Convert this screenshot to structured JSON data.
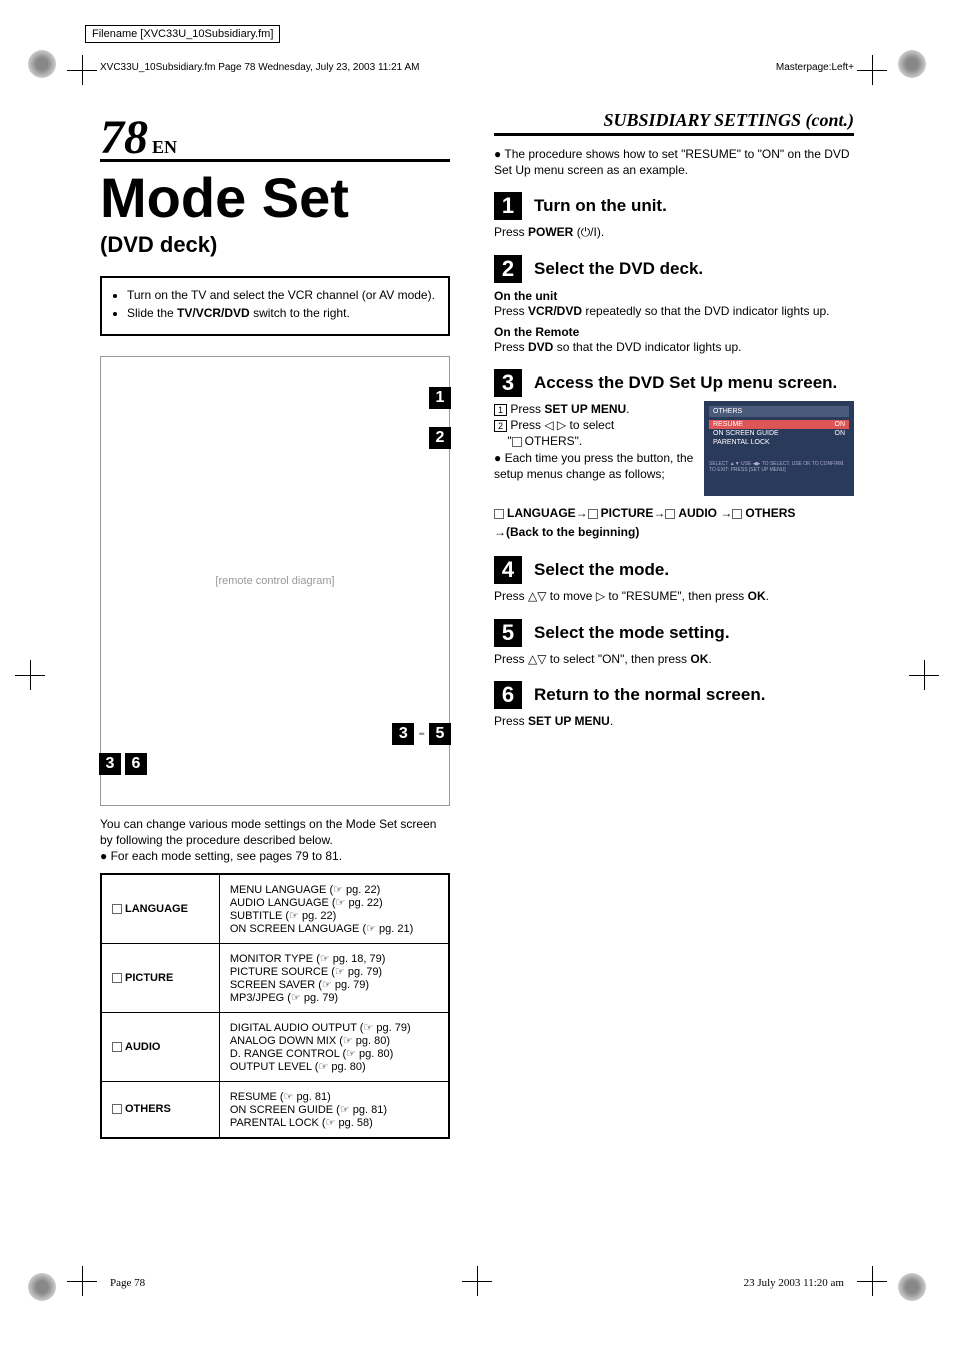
{
  "meta": {
    "filename_box": "Filename [XVC33U_10Subsidiary.fm]",
    "header_line": "XVC33U_10Subsidiary.fm  Page 78  Wednesday, July 23, 2003  11:21 AM",
    "masterpage": "Masterpage:Left+",
    "footer_left": "Page 78",
    "footer_right": "23 July 2003 11:20 am"
  },
  "page": {
    "number": "78",
    "lang": "EN",
    "section_header": "SUBSIDIARY SETTINGS (cont.)",
    "main_title": "Mode Set",
    "sub_title": "(DVD deck)"
  },
  "prep": {
    "items": [
      "Turn on the TV and select the VCR channel (or AV mode).",
      "Slide the TV/VCR/DVD switch to the right."
    ]
  },
  "remote_callouts": {
    "c1": "1",
    "c2": "2",
    "c35a": "3",
    "c35dash": " - ",
    "c35b": "5",
    "c3": "3",
    "c6": "6"
  },
  "left_body": {
    "l1": "You can change various mode settings on the Mode Set screen by following the procedure described below.",
    "l2": "● For each mode setting, see pages 79 to 81."
  },
  "mode_table": [
    {
      "label": "LANGUAGE",
      "items": [
        "MENU LANGUAGE (☞ pg. 22)",
        "AUDIO LANGUAGE (☞ pg. 22)",
        "SUBTITLE (☞ pg. 22)",
        "ON SCREEN LANGUAGE (☞ pg. 21)"
      ]
    },
    {
      "label": "PICTURE",
      "items": [
        "MONITOR TYPE (☞ pg. 18, 79)",
        "PICTURE SOURCE (☞ pg. 79)",
        "SCREEN SAVER (☞ pg. 79)",
        "MP3/JPEG (☞ pg. 79)"
      ]
    },
    {
      "label": "AUDIO",
      "items": [
        "DIGITAL AUDIO OUTPUT (☞ pg. 79)",
        "ANALOG DOWN MIX (☞ pg. 80)",
        "D. RANGE CONTROL (☞ pg. 80)",
        "OUTPUT LEVEL (☞ pg. 80)"
      ]
    },
    {
      "label": "OTHERS",
      "items": [
        "RESUME (☞ pg. 81)",
        "ON SCREEN GUIDE (☞ pg. 81)",
        "PARENTAL LOCK (☞ pg. 58)"
      ]
    }
  ],
  "right_intro": "● The procedure shows how to set \"RESUME\" to \"ON\" on the DVD Set Up menu screen as an example.",
  "steps": [
    {
      "num": "1",
      "title": "Turn on the unit.",
      "body": "Press POWER (⏻/I)."
    },
    {
      "num": "2",
      "title": "Select the DVD deck.",
      "sub1_label": "On the unit",
      "sub1_body": "Press VCR/DVD repeatedly so that the DVD indicator lights up.",
      "sub2_label": "On the Remote",
      "sub2_body": "Press DVD so that the DVD indicator lights up."
    },
    {
      "num": "3",
      "title": "Access the DVD Set Up menu screen.",
      "list": [
        "Press SET UP MENU.",
        "Press ◁ ▷ to select \" OTHERS\"."
      ],
      "bullet": "● Each time you press the button, the setup menus change as follows;",
      "osd": {
        "title": "OTHERS",
        "rows": [
          {
            "k": "RESUME",
            "v": "ON",
            "sel": true
          },
          {
            "k": "ON SCREEN GUIDE",
            "v": "ON",
            "sel": false
          },
          {
            "k": "PARENTAL LOCK",
            "v": "",
            "sel": false
          }
        ],
        "foot": "SELECT ▲▼ USE ◀▶ TO SELECT. USE OK TO CONFIRM. TO EXIT: PRESS [SET UP MENU]"
      },
      "flow": " LANGUAGE→ PICTURE→ AUDIO → OTHERS →(Back to the beginning)"
    },
    {
      "num": "4",
      "title": "Select the mode.",
      "body": "Press △▽ to move ▷ to \"RESUME\", then press OK."
    },
    {
      "num": "5",
      "title": "Select the mode setting.",
      "body": "Press △▽ to select \"ON\", then press OK."
    },
    {
      "num": "6",
      "title": "Return to the normal screen.",
      "body": "Press SET UP MENU."
    }
  ]
}
